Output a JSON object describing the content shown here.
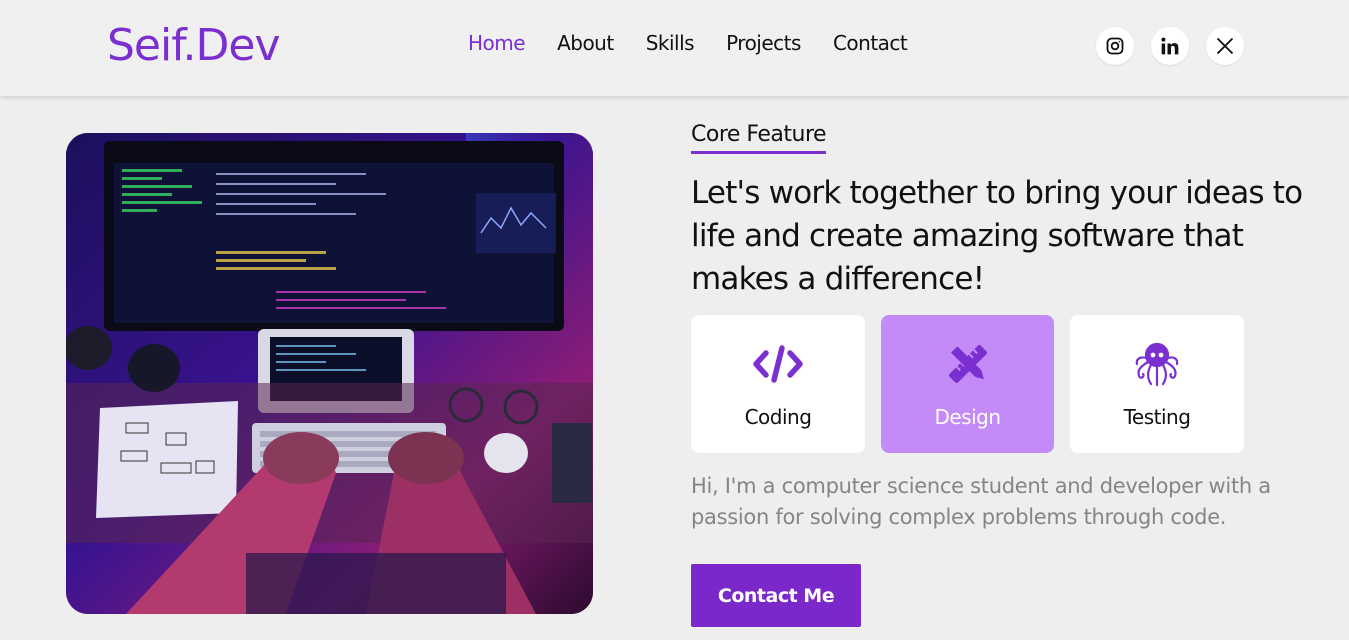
{
  "header": {
    "logo": "Seif.Dev",
    "nav": [
      {
        "label": "Home",
        "active": true
      },
      {
        "label": "About",
        "active": false
      },
      {
        "label": "Skills",
        "active": false
      },
      {
        "label": "Projects",
        "active": false
      },
      {
        "label": "Contact",
        "active": false
      }
    ],
    "socials": [
      "instagram-icon",
      "linkedin-icon",
      "x-icon"
    ]
  },
  "hero": {
    "image": "developer-workstation-photo"
  },
  "main": {
    "section_label": "Core Feature",
    "headline": "Let's work together to bring your ideas to life and create amazing software that makes a difference!",
    "cards": [
      {
        "label": "Coding",
        "icon": "code-icon"
      },
      {
        "label": "Design",
        "icon": "design-tools-icon",
        "active": true
      },
      {
        "label": "Testing",
        "icon": "octopus-icon"
      }
    ],
    "intro": "Hi, I'm a computer science student and developer with a passion for solving complex problems through code.",
    "cta_label": "Contact Me"
  },
  "colors": {
    "accent": "#7b2fd0",
    "card_active": "#c48af7",
    "button": "#7a28c9",
    "background": "#eeeeee",
    "muted_text": "#858585"
  }
}
